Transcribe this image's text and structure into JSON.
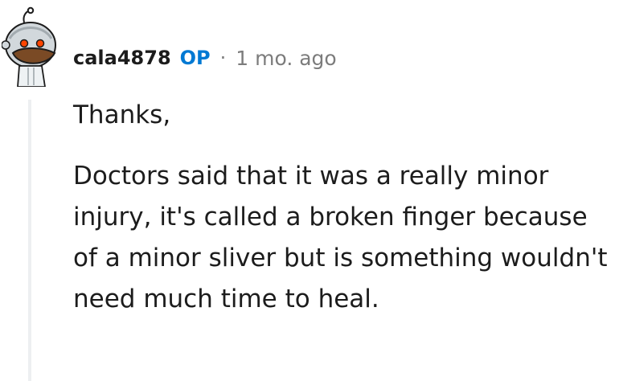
{
  "comment": {
    "username": "cala4878",
    "op_badge": "OP",
    "separator": "·",
    "timestamp": "1 mo. ago",
    "paragraphs": [
      "Thanks,",
      "Doctors said that it was a really minor injury, it's called a broken finger because of a minor sliver but is something wouldn't need much time to heal."
    ]
  },
  "colors": {
    "op_accent": "#0079d3",
    "meta_gray": "#7c7c7c",
    "thread_line": "#edeff1",
    "avatar_bg": "#e6ecf0",
    "avatar_accent": "#ff4500"
  },
  "icons": {
    "avatar": "snoo-avatar-icon"
  }
}
